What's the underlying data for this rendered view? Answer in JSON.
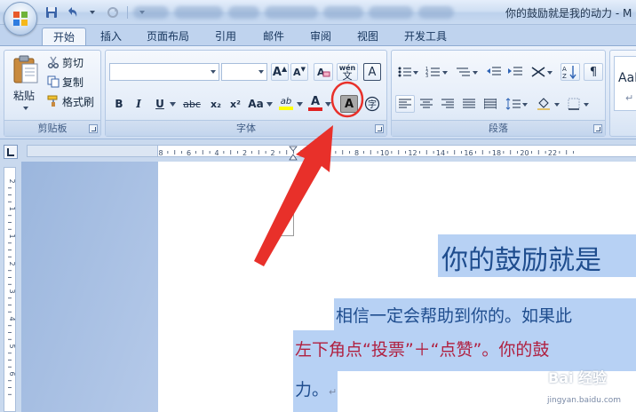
{
  "titlebar": {
    "title": "你的鼓励就是我的动力 - M"
  },
  "tabs": [
    "开始",
    "插入",
    "页面布局",
    "引用",
    "邮件",
    "审阅",
    "视图",
    "开发工具"
  ],
  "clipboard": {
    "paste": "粘贴",
    "cut": "剪切",
    "copy": "复制",
    "format_painter": "格式刷",
    "group_label": "剪贴板"
  },
  "font": {
    "group_label": "字体",
    "bold": "B",
    "italic": "I",
    "underline": "U",
    "strike": "abc",
    "subscript": "x₂",
    "superscript": "x²",
    "change_case": "Aa",
    "highlight": "ab",
    "font_color": "A",
    "grow": "A",
    "shrink": "A",
    "clear": "A",
    "phonetic": "wén",
    "phonetic_char": "文",
    "border_char": "A",
    "shading_char": "A",
    "enclose_char": "字"
  },
  "paragraph": {
    "group_label": "段落"
  },
  "styles": {
    "preview": "AaI"
  },
  "ruler": {
    "top_labels": [
      "8",
      "6",
      "4",
      "2",
      "2",
      "4",
      "6",
      "8",
      "10",
      "12",
      "14",
      "16",
      "18",
      "20",
      "22"
    ],
    "side_labels": [
      "2",
      "1",
      "1",
      "2",
      "3",
      "4",
      "5",
      "6"
    ]
  },
  "document": {
    "heading": "你的鼓励就是",
    "line1": "相信一定会帮助到你的。如果此",
    "line2": "左下角点“投票”＋“点赞”。你的鼓",
    "line3": "力。",
    "para_mark": "↵"
  },
  "watermark": {
    "main": "Bai 经验",
    "sub": "jingyan.baidu.com"
  },
  "colors": {
    "accent": "#e8302a",
    "highlight": "#b7d1f4"
  }
}
